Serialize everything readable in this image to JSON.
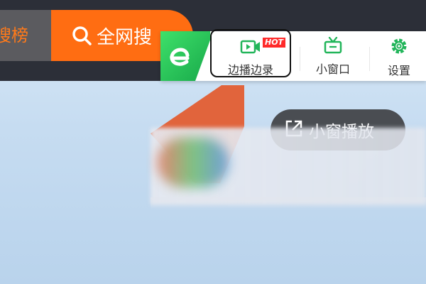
{
  "top_tabs": {
    "hot_rank_label": "搜榜",
    "search_label": "全网搜"
  },
  "toolbar": {
    "record": {
      "label": "边播边录",
      "badge": "HOT",
      "icon": "video-record-icon",
      "highlighted": true
    },
    "mini_window": {
      "label": "小窗口",
      "icon": "tv-icon"
    },
    "settings": {
      "label": "设置",
      "icon": "gear-icon"
    },
    "logo": "browser-e-logo"
  },
  "video_overlay": {
    "pip_label": "小窗播放",
    "pip_icon": "popout-icon",
    "arrow_icon": "arrow-pointer-icon"
  },
  "colors": {
    "accent_orange": "#ff6d12",
    "accent_green": "#22b55a",
    "hot_red": "#ff2a2a",
    "dark_bar": "#2c2f38"
  }
}
